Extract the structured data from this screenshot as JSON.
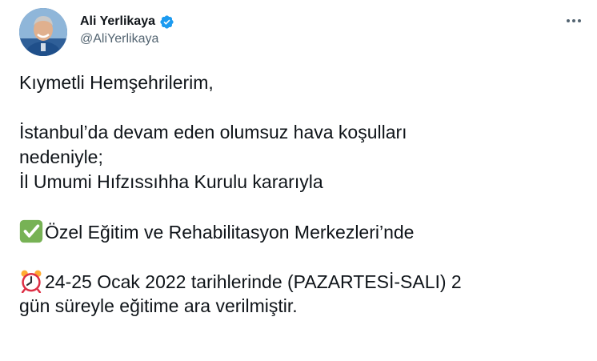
{
  "author": {
    "display_name": "Ali Yerlikaya",
    "handle": "@AliYerlikaya",
    "verified": true
  },
  "icons": {
    "verified": "verified-badge-icon",
    "more": "more-options-icon",
    "check": "check-mark-button-emoji",
    "alarm": "alarm-clock-emoji"
  },
  "colors": {
    "verified": "#1d9bf0",
    "text": "#0f1419",
    "secondary": "#536471",
    "check_emoji": "#77b255",
    "alarm_emoji": "#dd2e44"
  },
  "tweet": {
    "line1": "Kıymetli Hemşehrilerim,",
    "line2": "İstanbul’da devam eden olumsuz hava koşulları",
    "line3": "nedeniyle;",
    "line4": "İl Umumi Hıfzıssıhha Kurulu kararıyla",
    "line5": "Özel Eğitim ve Rehabilitasyon Merkezleri’nde",
    "line6": "24-25 Ocak 2022 tarihlerinde (PAZARTESİ-SALI) 2",
    "line7": "gün süreyle eğitime ara verilmiştir."
  }
}
